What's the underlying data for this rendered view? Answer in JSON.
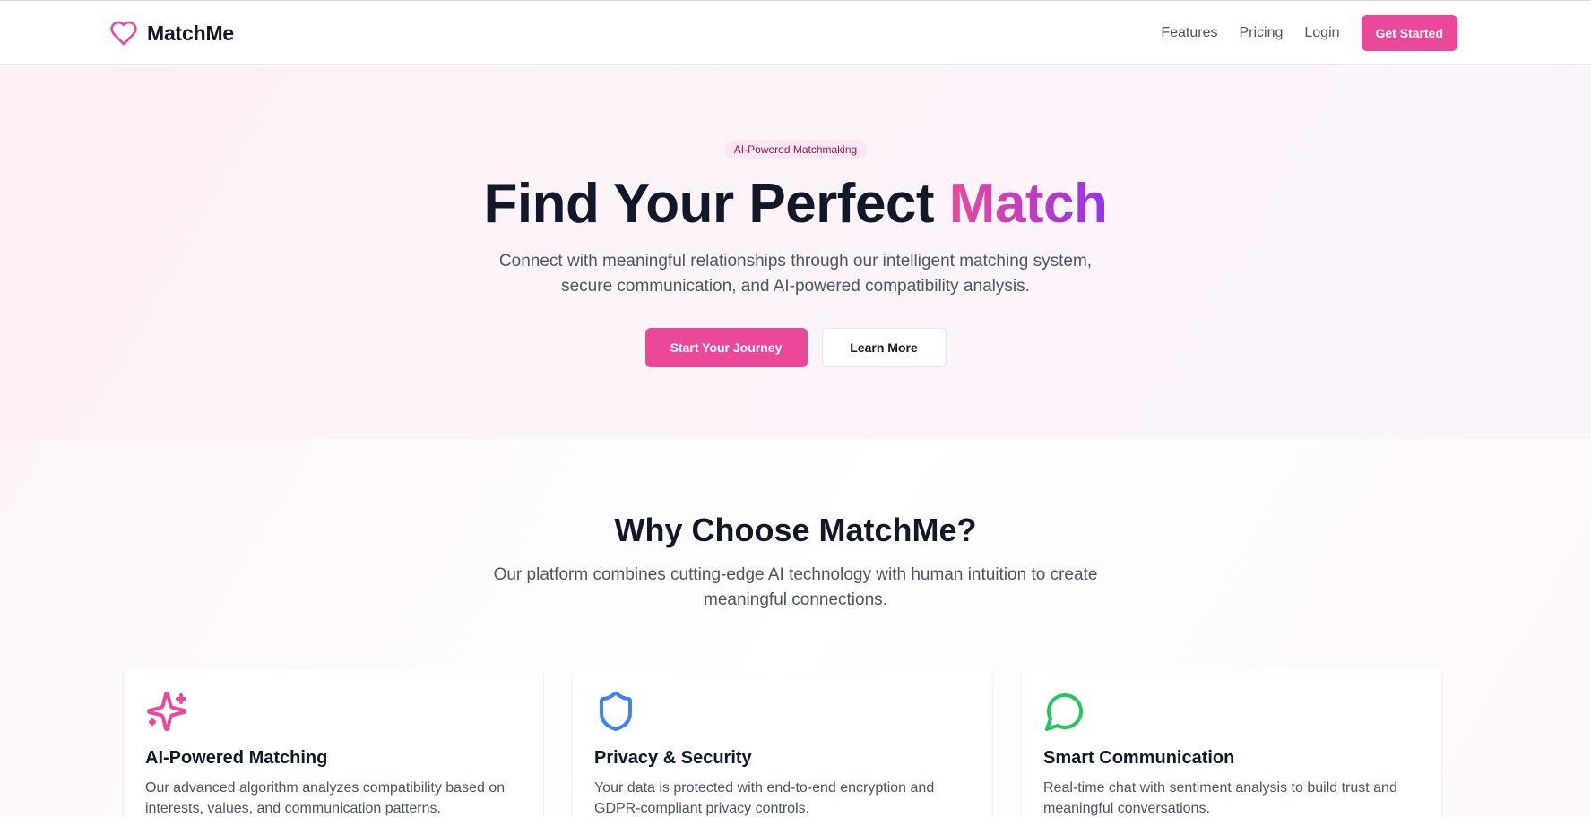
{
  "header": {
    "brand": "MatchMe",
    "nav": {
      "features": "Features",
      "pricing": "Pricing",
      "login": "Login",
      "get_started": "Get Started"
    }
  },
  "hero": {
    "badge": "AI-Powered Matchmaking",
    "title_main": "Find Your Perfect ",
    "title_accent": "Match",
    "subtitle": "Connect with meaningful relationships through our intelligent matching system, secure communication, and AI-powered compatibility analysis.",
    "primary_button": "Start Your Journey",
    "secondary_button": "Learn More"
  },
  "features": {
    "title": "Why Choose MatchMe?",
    "subtitle": "Our platform combines cutting-edge AI technology with human intuition to create meaningful connections.",
    "cards": [
      {
        "icon": "sparkles-icon",
        "title": "AI-Powered Matching",
        "description": "Our advanced algorithm analyzes compatibility based on interests, values, and communication patterns."
      },
      {
        "icon": "shield-icon",
        "title": "Privacy & Security",
        "description": "Your data is protected with end-to-end encryption and GDPR-compliant privacy controls."
      },
      {
        "icon": "message-circle-icon",
        "title": "Smart Communication",
        "description": "Real-time chat with sentiment analysis to build trust and meaningful conversations."
      }
    ]
  },
  "colors": {
    "brand_pink": "#ec4899",
    "accent_purple": "#9333ea",
    "shield_blue": "#3b82f6",
    "chat_green": "#22c55e",
    "text_dark": "#111827",
    "text_muted": "#4b5563"
  }
}
